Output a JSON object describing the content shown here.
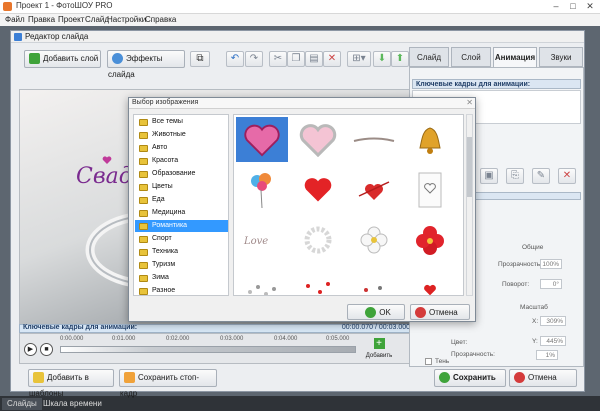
{
  "app": {
    "title": "Проект 1 - ФотоШОУ PRO",
    "menu": [
      "Файл",
      "Правка",
      "Проект",
      "Слайд",
      "Настройки",
      "Справка"
    ],
    "bottom_tabs": [
      "Слайды",
      "Шкала времени"
    ]
  },
  "editor": {
    "title": "Редактор слайда",
    "toolbar": {
      "add_layer": "Добавить слой",
      "slide_effects": "Эффекты слайда"
    },
    "canvas_text": "Сваде",
    "keyframes_label": "Ключевые кадры для анимации:",
    "keyframes_time": "00:00.070 / 00:03.000",
    "timeline_ticks": [
      "0:00.000",
      "0:01.000",
      "0:02.000",
      "0:03.000",
      "0:04.000",
      "0:05.000"
    ],
    "add_keyframe": "Добавить",
    "footer": {
      "add_to_templates": "Добавить в шаблоны",
      "save_frame": "Сохранить стоп-кадр",
      "save": "Сохранить",
      "cancel": "Отмена"
    }
  },
  "right_panel": {
    "tabs": [
      "Слайд",
      "Слой",
      "Анимация",
      "Звуки"
    ],
    "active_tab": "Анимация",
    "keyframes_header": "Ключевые кадры для анимации:",
    "section_general": "Общие",
    "transparency_label": "Прозрачность:",
    "transparency_value": "100%",
    "rotation_label": "Поворот:",
    "rotation_value": "0°",
    "scale_label": "Масштаб",
    "x_label": "X:",
    "x_value": "309%",
    "y_label": "Y:",
    "y_value": "445%",
    "shadow_label": "Тень",
    "color_label": "Цвет:",
    "shadow_transparency_label": "Прозрачность:",
    "shadow_transparency_value": "1%"
  },
  "modal": {
    "title": "Выбор изображения",
    "categories": [
      "Все темы",
      "Животные",
      "Авто",
      "Красота",
      "Образование",
      "Цветы",
      "Еда",
      "Медицина",
      "Романтика",
      "Спорт",
      "Техника",
      "Туризм",
      "Зима",
      "Разное"
    ],
    "selected_category": "Романтика",
    "ok": "OK",
    "cancel": "Отмена"
  }
}
